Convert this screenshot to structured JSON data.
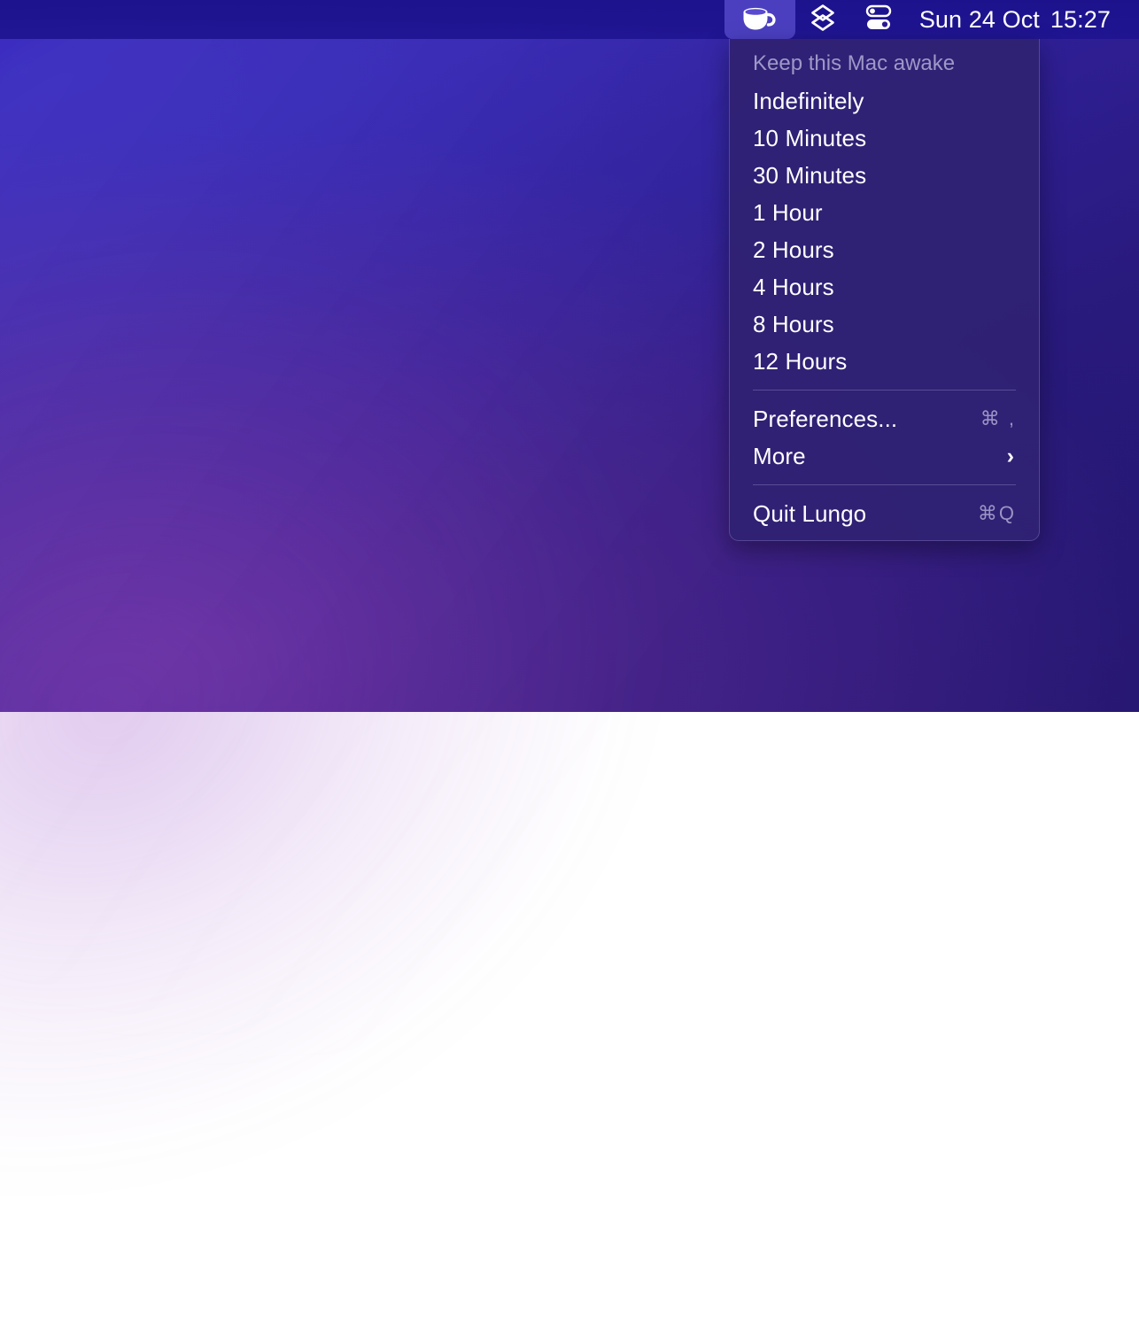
{
  "menubar": {
    "icons": [
      {
        "name": "coffee-cup-icon",
        "app": "Lungo",
        "active": true
      },
      {
        "name": "layers-stack-icon",
        "app": "Stats",
        "active": false
      },
      {
        "name": "control-center-sliders-icon",
        "app": "Control Center",
        "active": false
      }
    ],
    "clock": {
      "date": "Sun 24 Oct",
      "time": "15:27"
    }
  },
  "menu": {
    "header": "Keep this Mac awake",
    "duration_items": [
      {
        "label": "Indefinitely"
      },
      {
        "label": "10 Minutes"
      },
      {
        "label": "30 Minutes"
      },
      {
        "label": "1 Hour"
      },
      {
        "label": "2 Hours"
      },
      {
        "label": "4 Hours"
      },
      {
        "label": "8 Hours"
      },
      {
        "label": "12 Hours"
      }
    ],
    "action_items": [
      {
        "label": "Preferences...",
        "shortcut": "⌘ ,"
      },
      {
        "label": "More",
        "submenu_indicator": "›"
      }
    ],
    "quit_item": {
      "label": "Quit Lungo",
      "shortcut": "⌘Q"
    }
  },
  "colors": {
    "menubar_bg": "#1c128c",
    "panel_bg": "#302173",
    "active_icon_bg": "#4b3fc0",
    "text_primary": "#ffffff",
    "text_dimmed": "#9b94c6",
    "separator": "#aca4de",
    "wallpaper_blue": "#3526b8",
    "wallpaper_purple": "#4f2a91"
  }
}
